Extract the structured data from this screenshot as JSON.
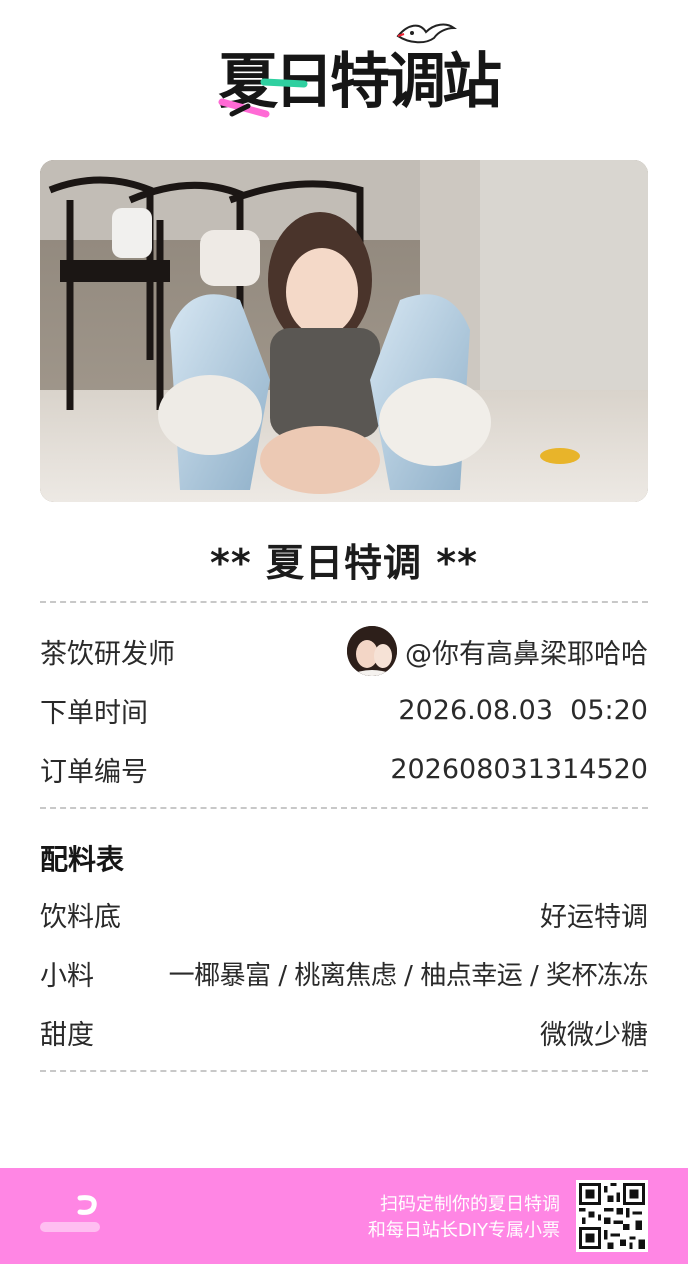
{
  "logo": {
    "text": "夏日特调站"
  },
  "receipt": {
    "title": "** 夏日特调 **",
    "rows": [
      {
        "label": "茶饮研发师",
        "value": "@你有高鼻梁耶哈哈"
      },
      {
        "label": "下单时间",
        "value": "2026.08.03  05:20"
      },
      {
        "label": "订单编号",
        "value": "202608031314520"
      }
    ],
    "recipe_title": "配料表",
    "recipe": [
      {
        "label": "饮料底",
        "value": "好运特调"
      },
      {
        "label": "小料",
        "value": "一椰暴富 / 桃离焦虑 / 柚点幸运 / 奖杯冻冻"
      },
      {
        "label": "甜度",
        "value": "微微少糖"
      }
    ]
  },
  "footer": {
    "line1": "扫码定制你的夏日特调",
    "line2": "和每日站长DIY专属小票"
  },
  "colors": {
    "footer_bg": "#ff86e4",
    "logo_pink": "#ff6ad5",
    "logo_green": "#2fd0a0"
  }
}
